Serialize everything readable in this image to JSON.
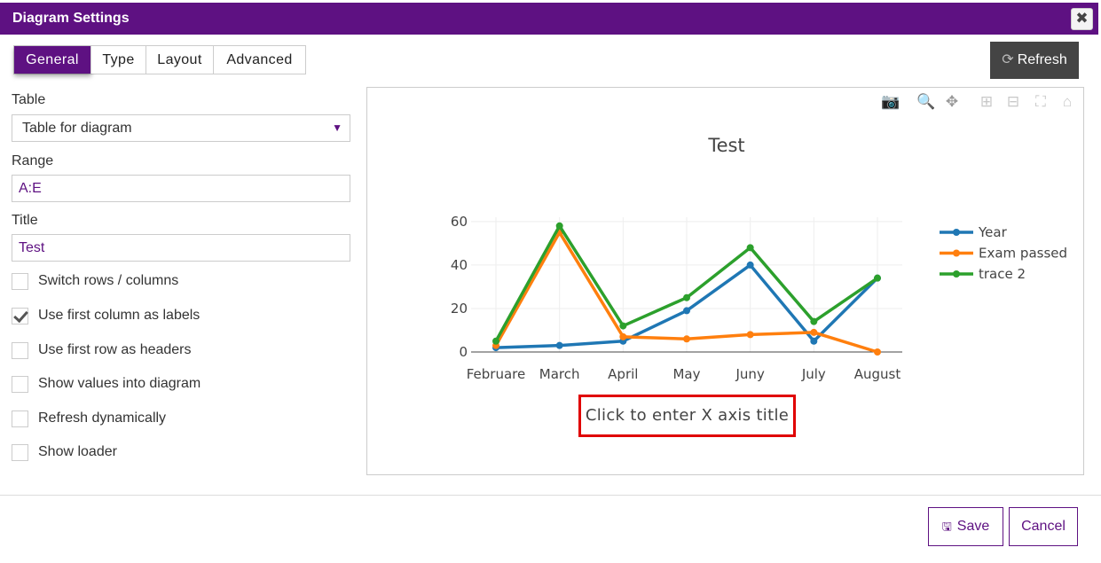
{
  "dialog": {
    "title": "Diagram Settings",
    "close_icon": "✖"
  },
  "tabs": [
    {
      "label": "General",
      "active": true
    },
    {
      "label": "Type",
      "active": false
    },
    {
      "label": "Layout",
      "active": false
    },
    {
      "label": "Advanced",
      "active": false
    }
  ],
  "toolbar": {
    "refresh_label": "Refresh",
    "refresh_icon": "⟳"
  },
  "form": {
    "table_label": "Table",
    "table_value": "Table for diagram",
    "range_label": "Range",
    "range_value": "A:E",
    "title_label": "Title",
    "title_value": "Test",
    "checkboxes": [
      {
        "label": "Switch rows / columns",
        "checked": false
      },
      {
        "label": "Use first column as labels",
        "checked": true
      },
      {
        "label": "Use first row as headers",
        "checked": false
      },
      {
        "label": "Show values into diagram",
        "checked": false
      },
      {
        "label": "Refresh dynamically",
        "checked": false
      },
      {
        "label": "Show loader",
        "checked": false
      }
    ]
  },
  "modebar_icons": [
    "camera-icon",
    "zoom-icon",
    "pan-icon",
    "zoom-in-icon",
    "zoom-out-icon",
    "autoscale-icon",
    "home-icon"
  ],
  "chart_data": {
    "type": "line",
    "title": "Test",
    "xlabel": "Click to enter X axis title",
    "categories": [
      "Februare",
      "March",
      "April",
      "May",
      "Juny",
      "July",
      "August"
    ],
    "ylim": [
      0,
      62
    ],
    "yticks": [
      0,
      20,
      40,
      60
    ],
    "grid": true,
    "legend": "right",
    "series": [
      {
        "name": "Year",
        "color": "#1f77b4",
        "values": [
          2,
          3,
          5,
          19,
          40,
          5,
          34
        ]
      },
      {
        "name": "Exam passed",
        "color": "#ff7f0e",
        "values": [
          3,
          55,
          7,
          6,
          8,
          9,
          0
        ]
      },
      {
        "name": "trace 2",
        "color": "#2ca02c",
        "values": [
          5,
          58,
          12,
          25,
          48,
          14,
          34
        ]
      }
    ]
  },
  "footer": {
    "save_label": "Save",
    "cancel_label": "Cancel",
    "save_icon": "🖫"
  }
}
